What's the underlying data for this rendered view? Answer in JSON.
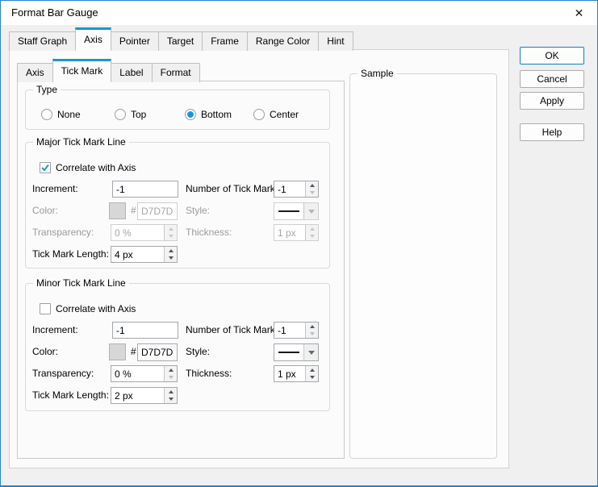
{
  "window": {
    "title": "Format Bar Gauge"
  },
  "icons": {
    "close": "✕"
  },
  "main_tabs": {
    "items": [
      "Staff Graph",
      "Axis",
      "Pointer",
      "Target",
      "Frame",
      "Range Color",
      "Hint"
    ],
    "active": "Axis"
  },
  "sub_tabs": {
    "items": [
      "Axis",
      "Tick Mark",
      "Label",
      "Format"
    ],
    "active": "Tick Mark"
  },
  "type_group": {
    "title": "Type",
    "options": [
      {
        "label": "None",
        "selected": false
      },
      {
        "label": "Top",
        "selected": false
      },
      {
        "label": "Bottom",
        "selected": true
      },
      {
        "label": "Center",
        "selected": false
      }
    ]
  },
  "major": {
    "title": "Major Tick Mark Line",
    "correlate": {
      "label": "Correlate with Axis",
      "checked": true
    },
    "increment": {
      "label": "Increment:",
      "value": "-1"
    },
    "num_ticks": {
      "label": "Number of Tick Marks:",
      "value": "-1"
    },
    "color": {
      "label": "Color:",
      "hash": "#",
      "hex": "D7D7D7",
      "swatch": "#D7D7D7",
      "enabled": false
    },
    "style": {
      "label": "Style:",
      "enabled": false
    },
    "transparency": {
      "label": "Transparency:",
      "value": "0 %",
      "enabled": false
    },
    "thickness": {
      "label": "Thickness:",
      "value": "1 px",
      "enabled": false
    },
    "length": {
      "label": "Tick Mark Length:",
      "value": "4 px"
    }
  },
  "minor": {
    "title": "Minor Tick Mark Line",
    "correlate": {
      "label": "Correlate with Axis",
      "checked": false
    },
    "increment": {
      "label": "Increment:",
      "value": "-1"
    },
    "num_ticks": {
      "label": "Number of Tick Marks:",
      "value": "-1"
    },
    "color": {
      "label": "Color:",
      "hash": "#",
      "hex": "D7D7D7",
      "swatch": "#D7D7D7",
      "enabled": true
    },
    "style": {
      "label": "Style:",
      "enabled": true
    },
    "transparency": {
      "label": "Transparency:",
      "value": "0 %",
      "enabled": true
    },
    "thickness": {
      "label": "Thickness:",
      "value": "1 px",
      "enabled": true
    },
    "length": {
      "label": "Tick Mark Length:",
      "value": "2 px"
    }
  },
  "sample": {
    "title": "Sample"
  },
  "buttons": {
    "ok": "OK",
    "cancel": "Cancel",
    "apply": "Apply",
    "help": "Help"
  },
  "colors": {
    "accent": "#1b95d9",
    "window_border": "#2584d0",
    "widget_blue": "#2196d8",
    "swatch_gray": "#d7d7d7"
  }
}
